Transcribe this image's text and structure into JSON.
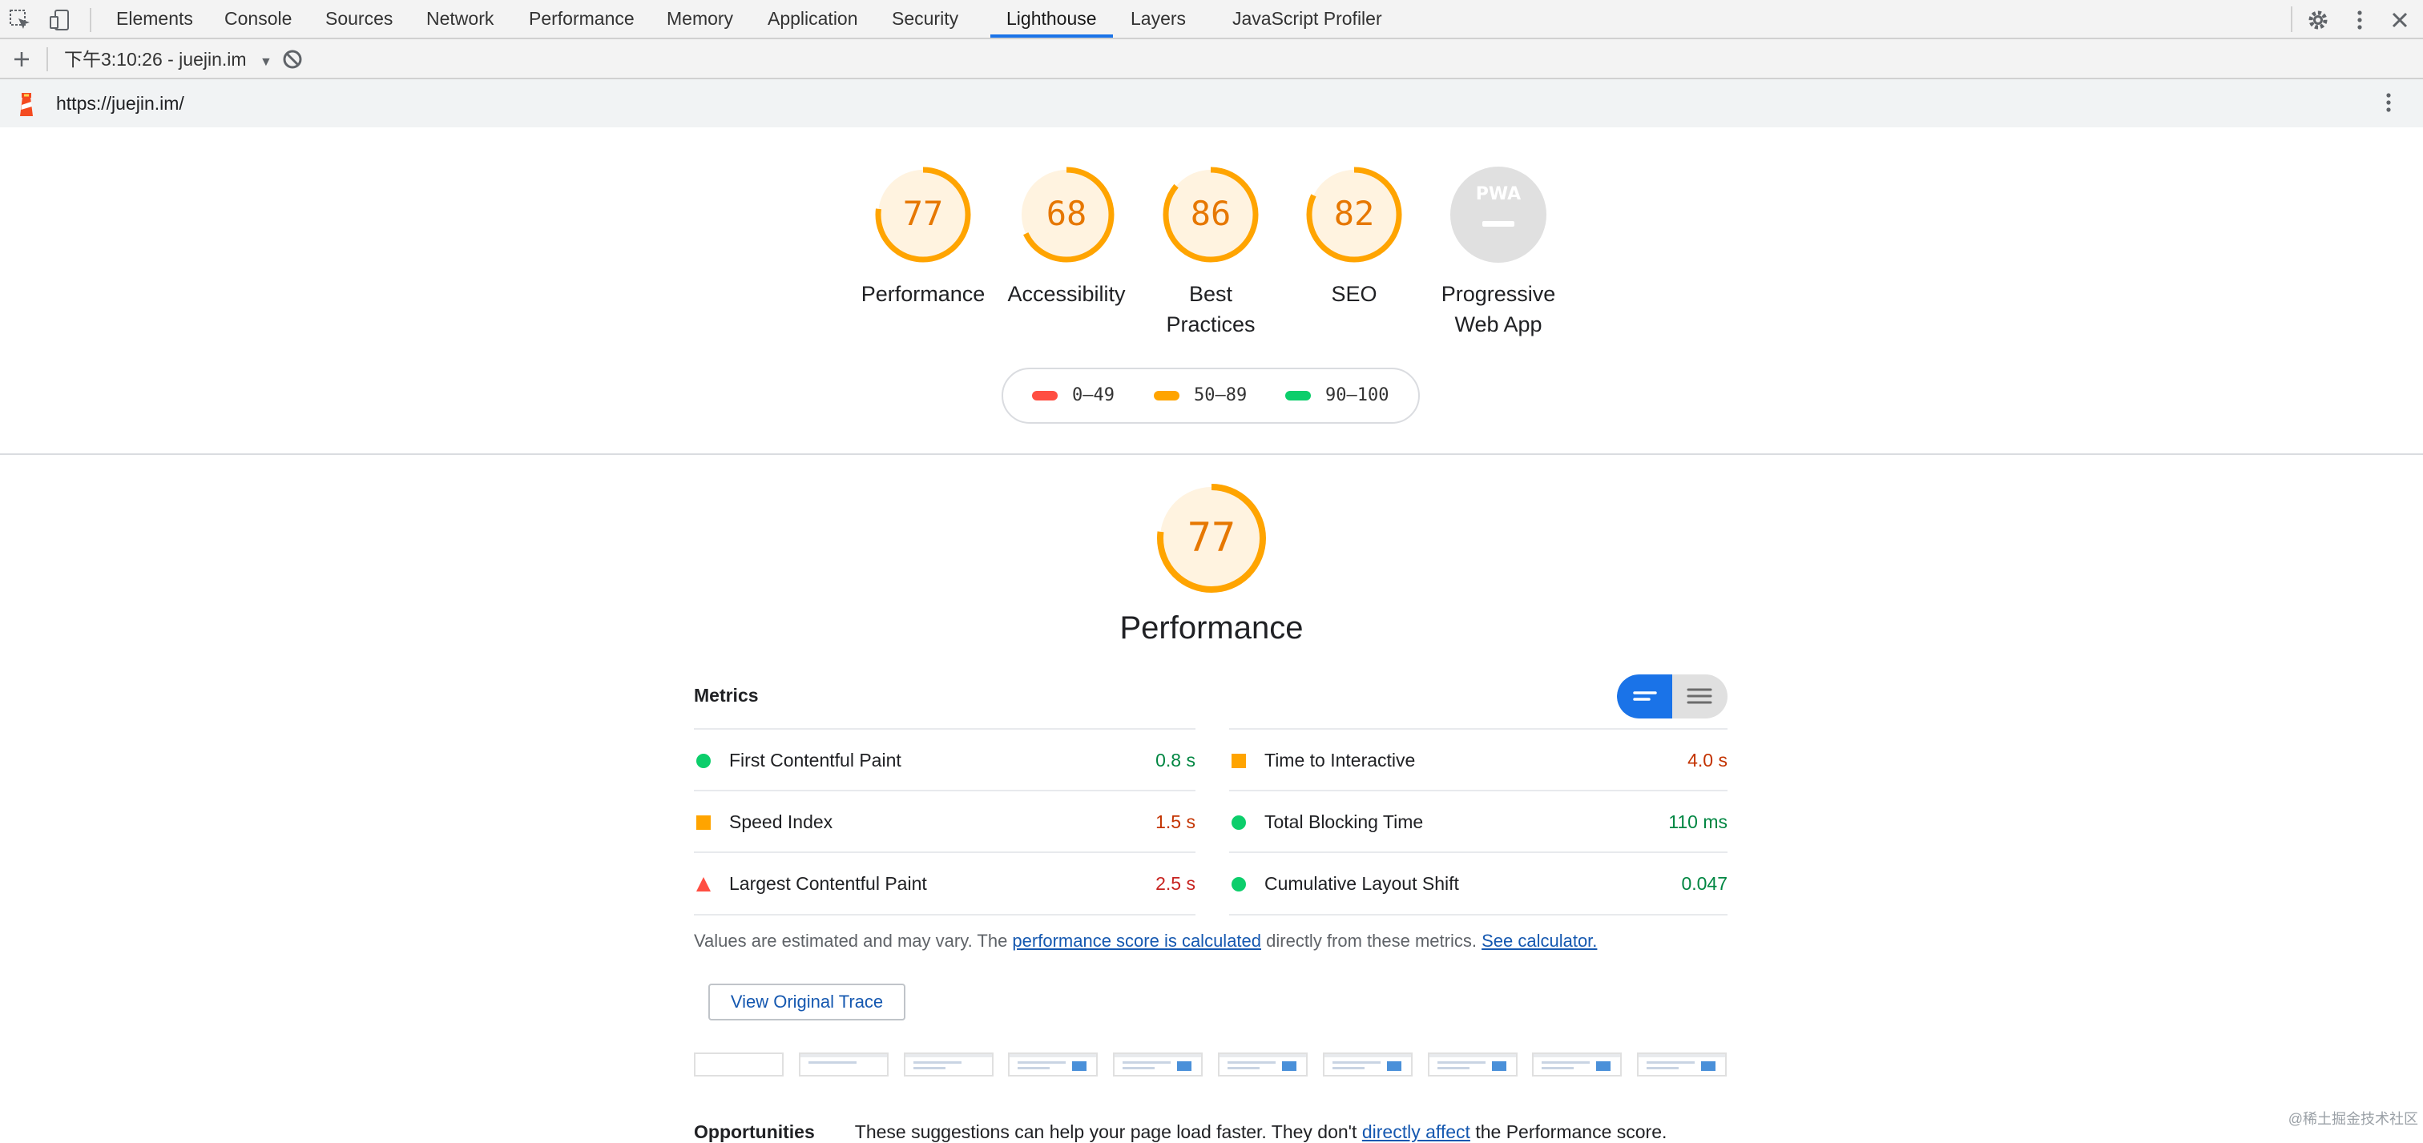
{
  "tabs": [
    {
      "label": "Elements"
    },
    {
      "label": "Console"
    },
    {
      "label": "Sources"
    },
    {
      "label": "Network"
    },
    {
      "label": "Performance"
    },
    {
      "label": "Memory"
    },
    {
      "label": "Application"
    },
    {
      "label": "Security"
    },
    {
      "label": "Lighthouse",
      "active": true
    },
    {
      "label": "Layers"
    },
    {
      "label": "JavaScript Profiler"
    }
  ],
  "toolbar": {
    "report": "下午3:10:26 - juejin.im"
  },
  "urlbar": {
    "url": "https://juejin.im/"
  },
  "gauges": [
    {
      "score": "77",
      "label_line1": "Performance",
      "label_line2": ""
    },
    {
      "score": "68",
      "label_line1": "Accessibility",
      "label_line2": ""
    },
    {
      "score": "86",
      "label_line1": "Best",
      "label_line2": "Practices"
    },
    {
      "score": "82",
      "label_line1": "SEO",
      "label_line2": ""
    }
  ],
  "pwa": {
    "badge": "PWA",
    "label_line1": "Progressive",
    "label_line2": "Web App"
  },
  "legend": [
    {
      "range": "0–49",
      "color": "#ff4e42"
    },
    {
      "range": "50–89",
      "color": "#ffa400"
    },
    {
      "range": "90–100",
      "color": "#0cce6b"
    }
  ],
  "performance": {
    "score": "77",
    "title": "Performance"
  },
  "metrics": {
    "title": "Metrics",
    "left": [
      {
        "name": "First Contentful Paint",
        "value": "0.8 s",
        "status": "pass"
      },
      {
        "name": "Speed Index",
        "value": "1.5 s",
        "status": "average"
      },
      {
        "name": "Largest Contentful Paint",
        "value": "2.5 s",
        "status": "fail"
      }
    ],
    "right": [
      {
        "name": "Time to Interactive",
        "value": "4.0 s",
        "status": "average"
      },
      {
        "name": "Total Blocking Time",
        "value": "110 ms",
        "status": "pass"
      },
      {
        "name": "Cumulative Layout Shift",
        "value": "0.047",
        "status": "pass"
      }
    ]
  },
  "estimate": {
    "prefix": "Values are estimated and may vary. The ",
    "link1": "performance score is calculated",
    "middle": " directly from these metrics. ",
    "link2": "See calculator."
  },
  "trace_button": "View Original Trace",
  "opportunities": {
    "title": "Opportunities",
    "text": "These suggestions can help your page load faster. They don't ",
    "link": "directly affect",
    "suffix": " the Performance score."
  },
  "watermark": "@稀土掘金技术社区",
  "colors": {
    "pass": "#0cce6b",
    "average": "#ffa400",
    "fail": "#ff4e42",
    "accent": "#1a73e8"
  }
}
